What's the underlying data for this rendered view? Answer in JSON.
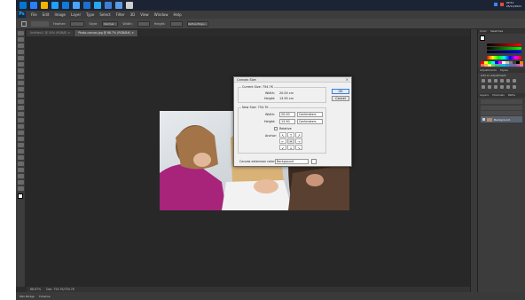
{
  "taskbar_top": {
    "icon_colors": [
      "#0078d4",
      "#2d7ff9",
      "#f3b200",
      "#1ea1ff",
      "#0f7bdc",
      "#4ba3ff",
      "#1f6fcf",
      "#28a8f0",
      "#3f7fd6",
      "#5a9be6",
      "#cfcfcf"
    ],
    "clock_time": "09:51",
    "clock_date": "25/11/2021"
  },
  "menubar": {
    "logo": "Ps",
    "items": [
      "File",
      "Edit",
      "Image",
      "Layer",
      "Type",
      "Select",
      "Filter",
      "3D",
      "View",
      "Window",
      "Help"
    ]
  },
  "options": {
    "feather_label": "Feather:",
    "style_label": "Style:",
    "style_value": "Normal",
    "width_label": "Width:",
    "height_label": "Height:",
    "refine_label": "Refine Edge..."
  },
  "tabs": [
    {
      "label": "Untitled-1 @ 50% (RGB/8) ×",
      "active": false
    },
    {
      "label": "Photo-canvas.jpg @ 66.7% (RGB/8#) ×",
      "active": true
    }
  ],
  "status": {
    "zoom": "66.67%",
    "doc": "Doc: 754.7K/754.7K"
  },
  "taskbar_bottom": {
    "items": [
      "Mini Bridge",
      "Timeline"
    ]
  },
  "panels": {
    "color_tabs": [
      "Color",
      "Swatches"
    ],
    "adjust_tabs": [
      "Adjustments",
      "Styles"
    ],
    "adjust_label": "Add an adjustment",
    "layers_tabs": [
      "Layers",
      "Channels",
      "Paths"
    ],
    "layer_name": "Background",
    "swatch_colors": [
      "#ff0000",
      "#ffff00",
      "#00ff00",
      "#00ffff",
      "#0000ff",
      "#ff00ff",
      "#ffffff",
      "#c0c0c0",
      "#808080",
      "#404040",
      "#000000",
      "#ff8000",
      "#f26c4f",
      "#fbaf5d",
      "#fff568",
      "#7cc576",
      "#3bb878",
      "#1cbbb4",
      "#00bff3",
      "#448ccb",
      "#5674b9",
      "#855fa8",
      "#a864a8",
      "#f06ea9"
    ]
  },
  "dialog": {
    "title": "Canvas Size",
    "close": "×",
    "current_label": "Current Size: 754.7K",
    "cur_width_label": "Width:",
    "cur_width_value": "20.00 cm",
    "cur_height_label": "Height:",
    "cur_height_value": "13.90 cm",
    "new_label": "New Size: 754.7K",
    "width_label": "Width:",
    "width_value": "20.00",
    "width_unit": "Centimeters",
    "height_label": "Height:",
    "height_value": "13.90",
    "height_unit": "Centimeters",
    "relative_label": "Relative",
    "anchor_label": "Anchor:",
    "anchor_arrows": [
      "↖",
      "↑",
      "↗",
      "←",
      "•",
      "→",
      "↙",
      "↓",
      "↘"
    ],
    "extension_label": "Canvas extension color:",
    "extension_value": "Background",
    "ok_label": "OK",
    "cancel_label": "Cancel"
  }
}
